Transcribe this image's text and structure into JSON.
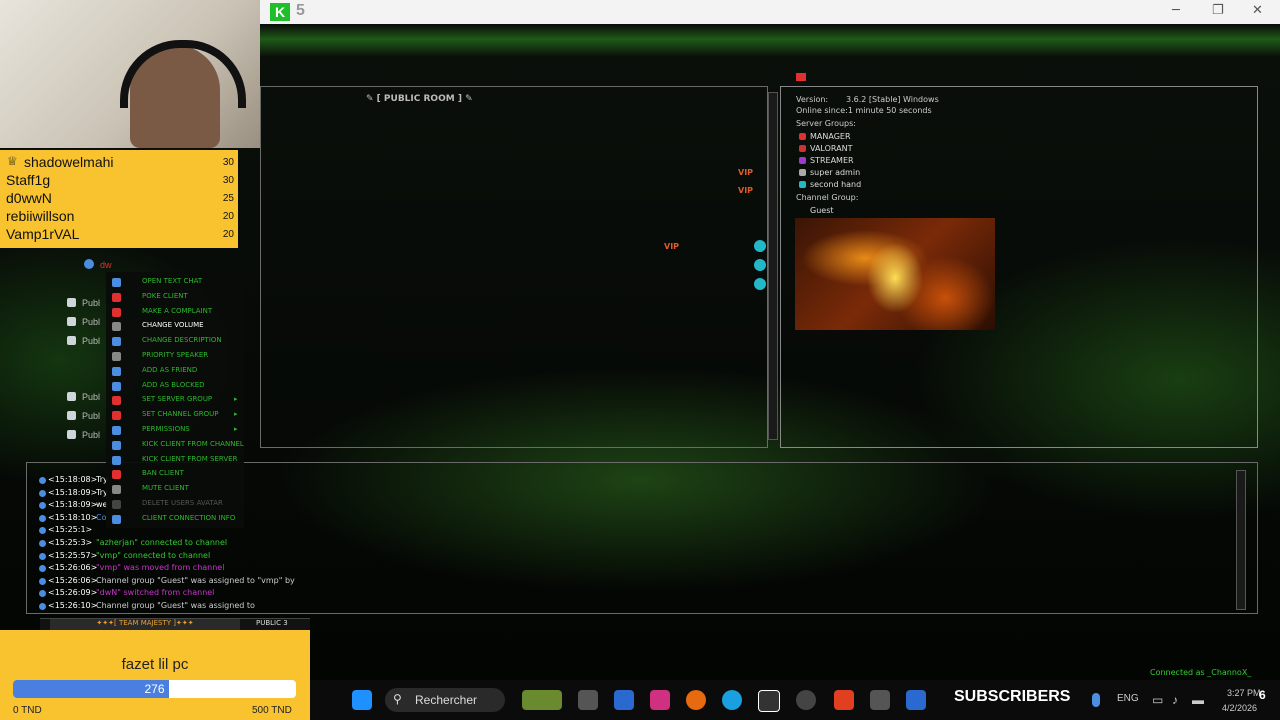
{
  "app": {
    "title_number": "5"
  },
  "window": {
    "minimize": "─",
    "maximize": "❐",
    "close": "✕"
  },
  "channel": {
    "title": "✎ [ PUBLIC ROOM ] ✎"
  },
  "leaderboard": {
    "items": [
      {
        "name": "shadowelmahi",
        "score": "30"
      },
      {
        "name": "Staff1g",
        "score": "30"
      },
      {
        "name": "d0wwN",
        "score": "25"
      },
      {
        "name": "rebiiwillson",
        "score": "20"
      },
      {
        "name": "Vamp1rVAL",
        "score": "20"
      }
    ]
  },
  "tree": {
    "items": [
      "Publ",
      "Publ",
      "Publ",
      "Publ",
      "Publ",
      "Publ"
    ],
    "user_prefix": "dw"
  },
  "context_menu": {
    "items": [
      "OPEN TEXT CHAT",
      "POKE CLIENT",
      "MAKE A COMPLAINT",
      "CHANGE VOLUME",
      "CHANGE DESCRIPTION",
      "PRIORITY SPEAKER",
      "ADD AS FRIEND",
      "ADD AS BLOCKED",
      "SET SERVER GROUP",
      "SET CHANNEL GROUP",
      "PERMISSIONS",
      "KICK CLIENT FROM CHANNEL",
      "KICK CLIENT FROM SERVER",
      "BAN CLIENT",
      "MUTE CLIENT",
      "DELETE USERS AVATAR",
      "CLIENT CONNECTION INFO"
    ]
  },
  "info": {
    "version_label": "Version:",
    "version": "3.6.2 [Stable] Windows",
    "online": "Online since:1 minute 50 seconds",
    "server_groups_label": "Server Groups:",
    "groups": [
      "MANAGER",
      "VALORANT",
      "STREAMER",
      "super admin",
      "second hand"
    ],
    "channel_group_label": "Channel Group:",
    "channel_group": "Guest"
  },
  "badges": {
    "vip1": "VIP",
    "vip2": "VIP",
    "vip3": "VIP"
  },
  "log": {
    "lines": [
      {
        "ts": "<15:18:08>",
        "text": "Try",
        "color": "#ffffff"
      },
      {
        "ts": "<15:18:09>",
        "text": "Try",
        "color": "#ffffff"
      },
      {
        "ts": "<15:18:09>",
        "text": "we",
        "color": "#ffffff"
      },
      {
        "ts": "<15:18:10>",
        "text": "Co",
        "color": "#4b8de0"
      },
      {
        "ts": "<15:25:1>",
        "text": "",
        "color": "#e03030"
      },
      {
        "ts": "<15:25:3>",
        "text": "\"azherjan\" connected to channel",
        "color": "#33cc33"
      },
      {
        "ts": "<15:25:57>",
        "text": "\"vmp\" connected to channel",
        "color": "#33cc33"
      },
      {
        "ts": "<15:26:06>",
        "text": "\"vmp\" was moved from channel",
        "color": "#cc33cc"
      },
      {
        "ts": "<15:26:06>",
        "text": "Channel group \"Guest\" was assigned to \"vmp\" by",
        "color": "#cccccc"
      },
      {
        "ts": "<15:26:09>",
        "text": "\"dwN\" switched from channel",
        "color": "#cc33cc"
      },
      {
        "ts": "<15:26:10>",
        "text": "Channel group \"Guest\" was assigned to",
        "color": "#cccccc"
      }
    ]
  },
  "bottom_tabs": [
    "✦✦✦[ TEAM MAJESTY ]✦✦✦",
    "PUBLIC 3"
  ],
  "donation": {
    "title": "fazet lil pc",
    "current": "276",
    "progress": 0.552,
    "min": "0 TND",
    "max": "500 TND"
  },
  "taskbar": {
    "search": "Rechercher",
    "overlay": "SUBSCRIBERS",
    "lang": "ENG",
    "time": "3:27 PM",
    "date": "4/2/2026",
    "status": "Connected as _ChannoX_",
    "notif": "6"
  }
}
